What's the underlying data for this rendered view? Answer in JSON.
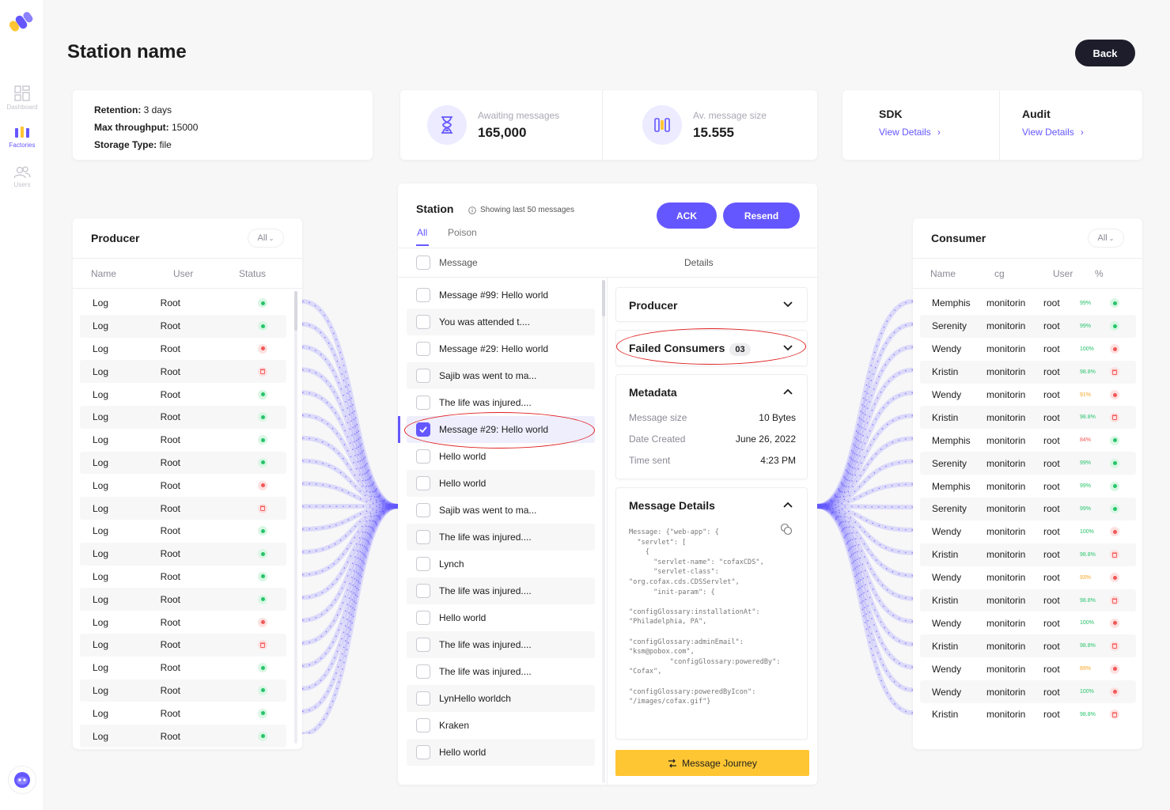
{
  "sidebar": {
    "items": [
      {
        "label": "Dashboard",
        "icon": "dashboard-icon",
        "active": false
      },
      {
        "label": "Factories",
        "icon": "factories-icon",
        "active": true
      },
      {
        "label": "Users",
        "icon": "users-icon",
        "active": false
      }
    ]
  },
  "header": {
    "title": "Station name",
    "back_label": "Back"
  },
  "info": {
    "retention_label": "Retention:",
    "retention_value": "3 days",
    "throughput_label": "Max throughput:",
    "throughput_value": "15000",
    "storage_label": "Storage Type:",
    "storage_value": "file"
  },
  "stats": {
    "awaiting_label": "Awaiting messages",
    "awaiting_value": "165,000",
    "avgsize_label": "Av. message size",
    "avgsize_value": "15.555"
  },
  "links": {
    "sdk_title": "SDK",
    "sdk_link": "View Details",
    "audit_title": "Audit",
    "audit_link": "View Details"
  },
  "producer": {
    "title": "Producer",
    "filter": "All",
    "columns": [
      "Name",
      "User",
      "Status"
    ],
    "rows": [
      {
        "name": "Log",
        "user": "Root",
        "status": "ok"
      },
      {
        "name": "Log",
        "user": "Root",
        "status": "ok"
      },
      {
        "name": "Log",
        "user": "Root",
        "status": "err"
      },
      {
        "name": "Log",
        "user": "Root",
        "status": "del"
      },
      {
        "name": "Log",
        "user": "Root",
        "status": "ok"
      },
      {
        "name": "Log",
        "user": "Root",
        "status": "ok"
      },
      {
        "name": "Log",
        "user": "Root",
        "status": "ok"
      },
      {
        "name": "Log",
        "user": "Root",
        "status": "ok"
      },
      {
        "name": "Log",
        "user": "Root",
        "status": "err"
      },
      {
        "name": "Log",
        "user": "Root",
        "status": "del"
      },
      {
        "name": "Log",
        "user": "Root",
        "status": "ok"
      },
      {
        "name": "Log",
        "user": "Root",
        "status": "ok"
      },
      {
        "name": "Log",
        "user": "Root",
        "status": "ok"
      },
      {
        "name": "Log",
        "user": "Root",
        "status": "ok"
      },
      {
        "name": "Log",
        "user": "Root",
        "status": "err"
      },
      {
        "name": "Log",
        "user": "Root",
        "status": "del"
      },
      {
        "name": "Log",
        "user": "Root",
        "status": "ok"
      },
      {
        "name": "Log",
        "user": "Root",
        "status": "ok"
      },
      {
        "name": "Log",
        "user": "Root",
        "status": "ok"
      },
      {
        "name": "Log",
        "user": "Root",
        "status": "ok"
      }
    ]
  },
  "station": {
    "title": "Station",
    "note": "Showing last 50 messages",
    "ack_label": "ACK",
    "resend_label": "Resend",
    "tabs": [
      "All",
      "Poison"
    ],
    "col_message": "Message",
    "col_details": "Details",
    "messages": [
      {
        "text": "Message #99: Hello world",
        "checked": false
      },
      {
        "text": "You was attended t....",
        "checked": false
      },
      {
        "text": "Message #29: Hello world",
        "checked": false
      },
      {
        "text": "Sajib was went to ma...",
        "checked": false
      },
      {
        "text": "The life was injured....",
        "checked": false
      },
      {
        "text": "Message #29: Hello world",
        "checked": true
      },
      {
        "text": "Hello world",
        "checked": false
      },
      {
        "text": "Hello world",
        "checked": false
      },
      {
        "text": "Sajib was went to ma...",
        "checked": false
      },
      {
        "text": "The life was injured....",
        "checked": false
      },
      {
        "text": "Lynch",
        "checked": false
      },
      {
        "text": "The life was injured....",
        "checked": false
      },
      {
        "text": "Hello world",
        "checked": false
      },
      {
        "text": "The life was injured....",
        "checked": false
      },
      {
        "text": "The life was injured....",
        "checked": false
      },
      {
        "text": "LynHello worldch",
        "checked": false
      },
      {
        "text": "Kraken",
        "checked": false
      },
      {
        "text": "Hello world",
        "checked": false
      }
    ]
  },
  "details": {
    "producer_title": "Producer",
    "failed_title": "Failed Consumers",
    "failed_count": "03",
    "metadata_title": "Metadata",
    "meta": [
      {
        "key": "Message size",
        "value": "10 Bytes"
      },
      {
        "key": "Date Created",
        "value": "June 26, 2022"
      },
      {
        "key": "Time sent",
        "value": "4:23 PM"
      }
    ],
    "msg_details_title": "Message Details",
    "code": "Message: {\"web-app\": {\n  \"servlet\": [\n    {\n      \"servlet-name\": \"cofaxCDS\",\n      \"servlet-class\": \"org.cofax.cds.CDSServlet\",\n      \"init-param\": {\n\n\"configGlossary:installationAt\": \"Philadelphia, PA\",\n\n\"configGlossary:adminEmail\": \"ksm@pobox.com\",\n          \"configGlossary:poweredBy\": \"Cofax\",\n\n\"configGlossary:poweredByIcon\": \"/images/cofax.gif\"}",
    "journey_label": "Message Journey"
  },
  "consumer": {
    "title": "Consumer",
    "filter": "All",
    "columns": [
      "Name",
      "cg",
      "User",
      "%"
    ],
    "rows": [
      {
        "name": "Memphis",
        "cg": "monitorin",
        "user": "root",
        "pct": "99%",
        "status": "ok"
      },
      {
        "name": "Serenity",
        "cg": "monitorin",
        "user": "root",
        "pct": "99%",
        "status": "ok"
      },
      {
        "name": "Wendy",
        "cg": "monitorin",
        "user": "root",
        "pct": "100%",
        "status": "err"
      },
      {
        "name": "Kristin",
        "cg": "monitorin",
        "user": "root",
        "pct": "98.8%",
        "status": "del"
      },
      {
        "name": "Wendy",
        "cg": "monitorin",
        "user": "root",
        "pct": "91%",
        "status": "err"
      },
      {
        "name": "Kristin",
        "cg": "monitorin",
        "user": "root",
        "pct": "98.8%",
        "status": "del"
      },
      {
        "name": "Memphis",
        "cg": "monitorin",
        "user": "root",
        "pct": "84%",
        "status": "ok"
      },
      {
        "name": "Serenity",
        "cg": "monitorin",
        "user": "root",
        "pct": "99%",
        "status": "ok"
      },
      {
        "name": "Memphis",
        "cg": "monitorin",
        "user": "root",
        "pct": "99%",
        "status": "ok"
      },
      {
        "name": "Serenity",
        "cg": "monitorin",
        "user": "root",
        "pct": "99%",
        "status": "ok"
      },
      {
        "name": "Wendy",
        "cg": "monitorin",
        "user": "root",
        "pct": "100%",
        "status": "err"
      },
      {
        "name": "Kristin",
        "cg": "monitorin",
        "user": "root",
        "pct": "98.8%",
        "status": "del"
      },
      {
        "name": "Wendy",
        "cg": "monitorin",
        "user": "root",
        "pct": "93%",
        "status": "err"
      },
      {
        "name": "Kristin",
        "cg": "monitorin",
        "user": "root",
        "pct": "98.8%",
        "status": "del"
      },
      {
        "name": "Wendy",
        "cg": "monitorin",
        "user": "root",
        "pct": "100%",
        "status": "err"
      },
      {
        "name": "Kristin",
        "cg": "monitorin",
        "user": "root",
        "pct": "98.8%",
        "status": "del"
      },
      {
        "name": "Wendy",
        "cg": "monitorin",
        "user": "root",
        "pct": "89%",
        "status": "err"
      },
      {
        "name": "Wendy",
        "cg": "monitorin",
        "user": "root",
        "pct": "100%",
        "status": "err"
      },
      {
        "name": "Kristin",
        "cg": "monitorin",
        "user": "root",
        "pct": "98.8%",
        "status": "del"
      }
    ]
  },
  "colors": {
    "accent": "#6557ff",
    "journey": "#ffc633",
    "ok": "#27c46a",
    "err": "#f25757",
    "warn": "#f5a623",
    "dark": "#1d1d2b"
  }
}
